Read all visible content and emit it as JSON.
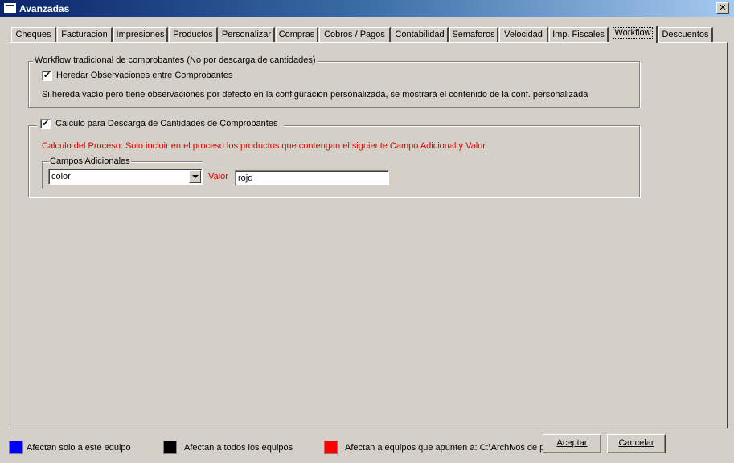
{
  "window": {
    "title": "Avanzadas",
    "close_symbol": "✕"
  },
  "tabs": [
    {
      "label": "Cheques",
      "active": false
    },
    {
      "label": "Facturacion",
      "active": false
    },
    {
      "label": "Impresiones",
      "active": false
    },
    {
      "label": "Productos",
      "active": false
    },
    {
      "label": "Personalizar",
      "active": false
    },
    {
      "label": "Compras",
      "active": false
    },
    {
      "label": "Cobros / Pagos",
      "active": false
    },
    {
      "label": "Contabilidad",
      "active": false
    },
    {
      "label": "Semaforos",
      "active": false
    },
    {
      "label": "Velocidad",
      "active": false
    },
    {
      "label": "Imp. Fiscales",
      "active": false
    },
    {
      "label": "Workflow",
      "active": true
    },
    {
      "label": "Descuentos",
      "active": false
    }
  ],
  "workflow_group": {
    "legend": "Workflow tradicional de comprobantes (No por descarga de cantidades)",
    "checkbox_label": "Heredar Observaciones entre Comprobantes",
    "checked": true,
    "description": "Si hereda vacío pero tiene observaciones por defecto en la configuracion personalizada, se mostrará el contenido de la conf. personalizada"
  },
  "calculo_group": {
    "checkbox_label": "Calculo para Descarga de Cantidades de Comprobantes",
    "checked": true,
    "info": "Calculo del Proceso: Solo incluir en el proceso los productos que contengan el siguiente Campo Adicional y Valor",
    "campos_label": "Campos Adicionales",
    "campo_value": "color",
    "valor_label": "Valor",
    "valor_value": "rojo"
  },
  "footer": {
    "legend_items": [
      {
        "label": "Afectan solo a este equipo",
        "color": "#0000ff"
      },
      {
        "label": "Afectan a todos los equipos",
        "color": "#000000"
      },
      {
        "label": "Afectan a equipos que apunten a: C:\\Archivos de p",
        "color": "#ff0000"
      }
    ],
    "accept_label": "Aceptar",
    "cancel_label": "Cancelar"
  },
  "colors": {
    "accent_red": "#e00000",
    "titlebar": "#0a246a",
    "face": "#d4d0c8"
  }
}
